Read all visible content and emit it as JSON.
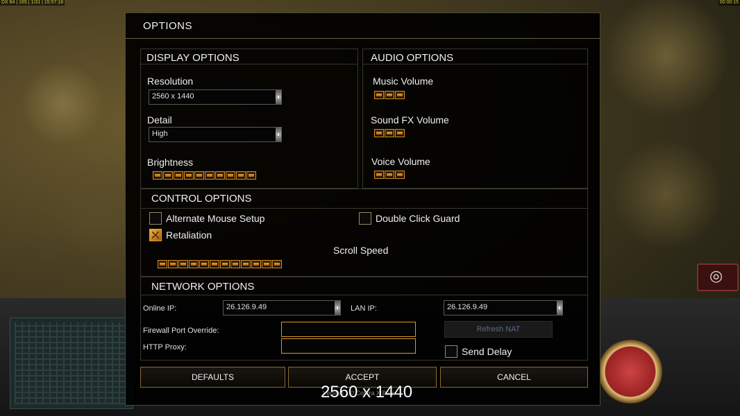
{
  "system": {
    "left_status": "DX 64 | 165 | 1/31 | 15:57:18",
    "right_clock": "00:00:15"
  },
  "dialog": {
    "title": "OPTIONS"
  },
  "display": {
    "title": "DISPLAY OPTIONS",
    "resolution_label": "Resolution",
    "resolution_value": "2560 x 1440",
    "detail_label": "Detail",
    "detail_value": "High",
    "brightness_label": "Brightness",
    "brightness_level": 1.0
  },
  "audio": {
    "title": "AUDIO OPTIONS",
    "music_label": "Music Volume",
    "music_level": 1.0,
    "sfx_label": "Sound FX Volume",
    "sfx_level": 1.0,
    "voice_label": "Voice Volume",
    "voice_level": 1.0
  },
  "control": {
    "title": "CONTROL OPTIONS",
    "alt_mouse_label": "Alternate Mouse Setup",
    "alt_mouse_checked": false,
    "double_click_label": "Double Click Guard",
    "double_click_checked": false,
    "retaliation_label": "Retaliation",
    "retaliation_checked": true,
    "scroll_speed_label": "Scroll Speed",
    "scroll_speed_level": 1.0
  },
  "network": {
    "title": "NETWORK OPTIONS",
    "online_ip_label": "Online IP:",
    "online_ip_value": "26.126.9.49",
    "lan_ip_label": "LAN IP:",
    "lan_ip_value": "26.126.9.49",
    "firewall_label": "Firewall Port Override:",
    "firewall_value": "",
    "http_proxy_label": "HTTP Proxy:",
    "http_proxy_value": "",
    "refresh_nat_label": "Refresh NAT",
    "send_delay_label": "Send Delay",
    "send_delay_checked": false
  },
  "buttons": {
    "defaults": "DEFAULTS",
    "accept": "ACCEPT",
    "cancel": "CANCEL"
  },
  "footer": {
    "version": "Version 1.0 Contra X Beta",
    "resolution_overlay": "2560 x 1440"
  }
}
